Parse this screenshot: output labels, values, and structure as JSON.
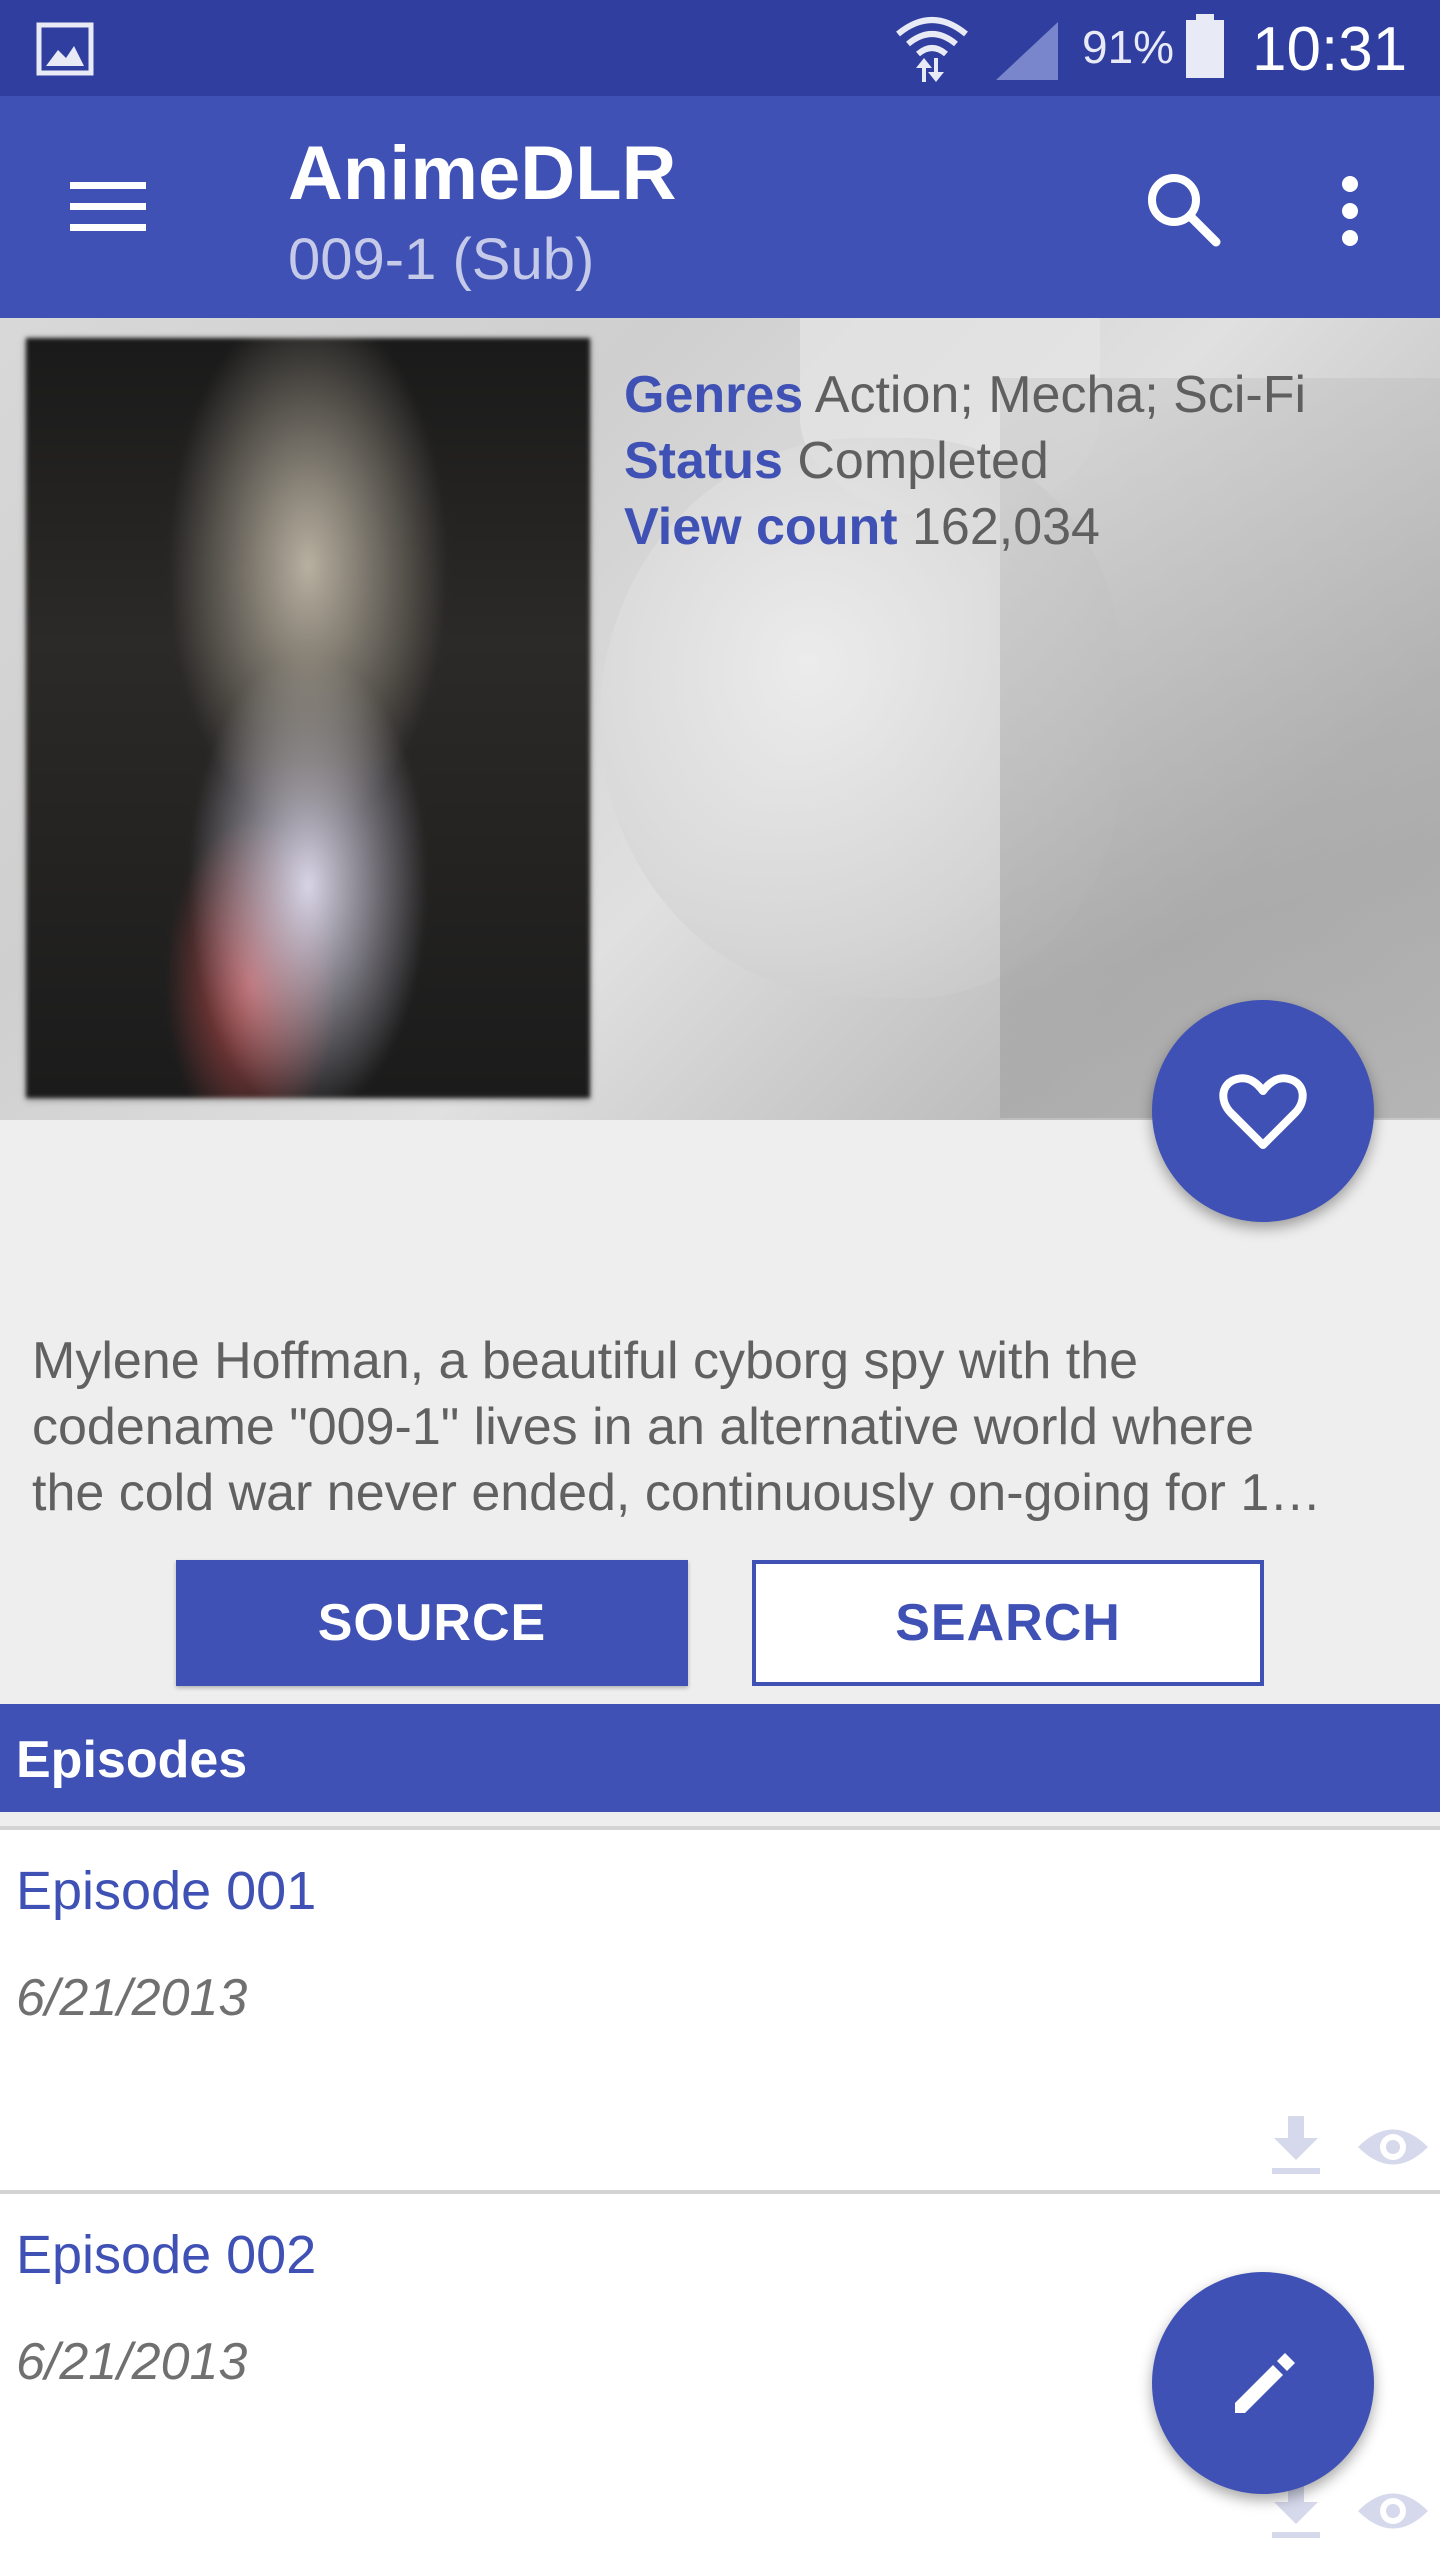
{
  "status_bar": {
    "battery_percent": "91%",
    "time": "10:31"
  },
  "toolbar": {
    "title": "AnimeDLR",
    "subtitle": "009-1 (Sub)"
  },
  "details": {
    "genres_label": "Genres",
    "genres_value": "Action; Mecha; Sci-Fi",
    "status_label": "Status",
    "status_value": "Completed",
    "view_count_label": "View count",
    "view_count_value": "162,034"
  },
  "description": {
    "line1": "Mylene Hoffman, a beautiful cyborg spy with the",
    "line2": "codename \"009-1\" lives in an alternative world where",
    "line3": "the cold war never ended, continuously on-going for 1…"
  },
  "buttons": {
    "source": "SOURCE",
    "search": "SEARCH"
  },
  "episodes": {
    "header": "Episodes",
    "items": [
      {
        "title": "Episode 001",
        "date": "6/21/2013"
      },
      {
        "title": "Episode 002",
        "date": "6/21/2013"
      }
    ]
  },
  "colors": {
    "primary": "#3f51b5",
    "primary_dark": "#303f9f",
    "background": "#eeeeee"
  },
  "icons": [
    "gallery-icon",
    "wifi-icon",
    "signal-icon",
    "battery-icon",
    "menu-icon",
    "search-icon",
    "more-vert-icon",
    "heart-icon",
    "download-icon",
    "eye-icon",
    "pencil-icon"
  ]
}
